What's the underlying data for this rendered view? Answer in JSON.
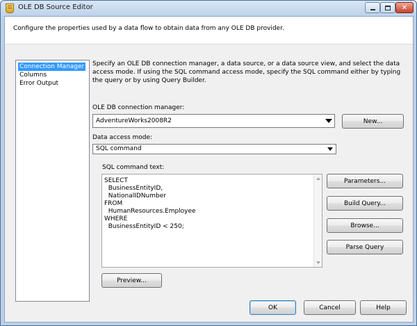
{
  "window": {
    "title": "OLE DB Source Editor",
    "minimize_icon": "minimize-icon",
    "maximize_icon": "maximize-icon",
    "close_icon": "close-icon",
    "close_symbol": "✕"
  },
  "header": {
    "description": "Configure the properties used by a data flow to obtain data from any OLE DB provider."
  },
  "nav": {
    "items": [
      {
        "label": "Connection Manager",
        "selected": true
      },
      {
        "label": "Columns",
        "selected": false
      },
      {
        "label": "Error Output",
        "selected": false
      }
    ]
  },
  "main": {
    "instructions": "Specify an OLE DB connection manager, a data source, or a data source view, and select the data access mode. If using the SQL command access mode, specify the SQL command either by typing the query or by using Query Builder.",
    "connection_label": "OLE DB connection manager:",
    "connection_value": "AdventureWorks2008R2",
    "new_button": "New...",
    "access_mode_label": "Data access mode:",
    "access_mode_value": "SQL command",
    "sql_label": "SQL command text:",
    "sql_lines": [
      "SELECT",
      "  BusinessEntityID,",
      "  NationalIDNumber",
      "FROM",
      "  HumanResources.Employee",
      "WHERE",
      "  BusinessEntityID < 250;"
    ],
    "parameters_button": "Parameters...",
    "build_query_button": "Build Query...",
    "browse_button": "Browse...",
    "parse_query_button": "Parse Query",
    "preview_button": "Preview..."
  },
  "footer": {
    "ok_button": "OK",
    "cancel_button": "Cancel",
    "help_button": "Help"
  },
  "colors": {
    "selection": "#3399ff",
    "title_bar": "#bdd2ea",
    "dialog_bg": "#f0f0f0"
  }
}
